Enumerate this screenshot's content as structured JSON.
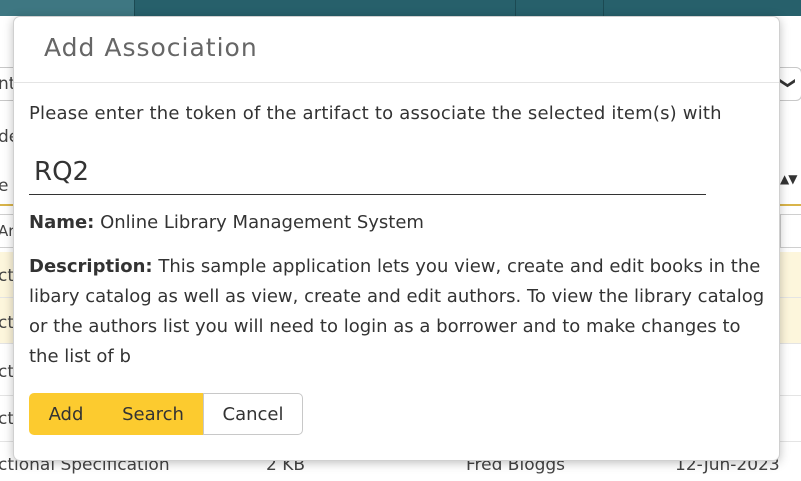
{
  "background": {
    "left_fragments": [
      "nt",
      "de",
      "e",
      "Ar",
      "ct",
      "ct",
      "ct",
      "ct"
    ],
    "select_right_glyph": "❯",
    "sort_glyph": "▲▼",
    "last_row": {
      "name": "ctional Specification",
      "size": "2 KB",
      "author": "Fred Bloggs",
      "date": "12-Jun-2023"
    }
  },
  "modal": {
    "title": "Add Association",
    "prompt": "Please enter the token of the artifact to associate the selected item(s) with",
    "token_value": "RQ2",
    "name_label": "Name:",
    "name_value": "Online Library Management System",
    "description_label": "Description:",
    "description_value": "This sample application lets you view, create and edit books in the libary catalog as well as view, create and edit authors. To view the library catalog or the authors list you will need to login as a borrower and to make changes to the list of b",
    "buttons": {
      "add": "Add",
      "search": "Search",
      "cancel": "Cancel"
    }
  },
  "colors": {
    "header": "#27606b",
    "accent": "#fccb2f",
    "row_highlight": "#fdf6dc"
  }
}
